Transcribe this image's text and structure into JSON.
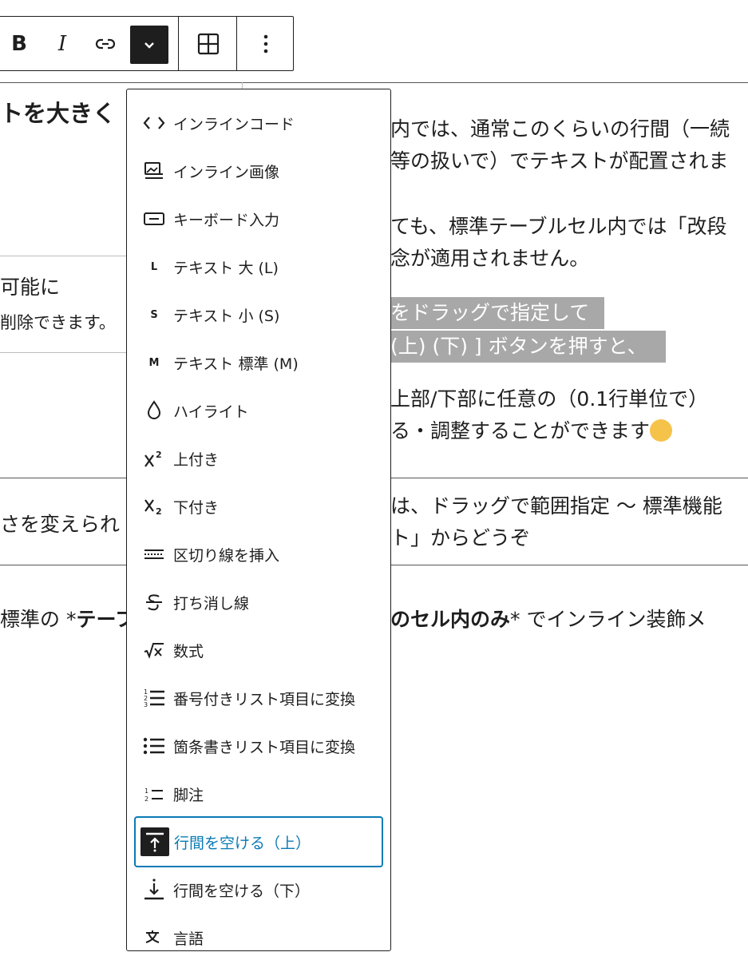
{
  "toolbar": {
    "bold_label": "B",
    "italic_label": "I",
    "link_icon": "link-icon",
    "more_icon": "chevron-down-icon",
    "table_icon": "table-grid-icon",
    "options_icon": "kebab-icon"
  },
  "content": {
    "r1_left": "トを大きく",
    "r1_right_1": "内では、通常このくらいの行間（一続",
    "r1_right_2": "等の扱いで）でテキストが配置されま",
    "r1_right_3": "ても、標準テーブルセル内では「改段",
    "r1_right_4": "念が適用されません。",
    "r2_left_1": "可能に",
    "r2_left_2": "削除できます。",
    "hl_1": "をドラッグで指定して",
    "hl_2": "(上) (下) ] ボタンを押すと、",
    "r2_right_1": "上部/下部に任意の（0.1行単位で）",
    "r2_right_2": "る・調整することができます",
    "r3_left": "さを変えられ",
    "r3_right_1": "は、ドラッグで範囲指定 〜 標準機能",
    "r3_right_2": "ト」からどうぞ",
    "bottom_a": "標準の *",
    "bottom_b": "テーフ",
    "bottom_c": "のセル内のみ",
    "bottom_d": "* でインライン装飾メ"
  },
  "menu": {
    "items": [
      {
        "label": "インラインコード",
        "icon": "code-icon"
      },
      {
        "label": "インライン画像",
        "icon": "image-icon"
      },
      {
        "label": "キーボード入力",
        "icon": "keyboard-icon",
        "glyph": ""
      },
      {
        "label": "テキスト 大 (L)",
        "icon": "text-large-icon",
        "glyph": "L"
      },
      {
        "label": "テキスト 小 (S)",
        "icon": "text-small-icon",
        "glyph": "S"
      },
      {
        "label": "テキスト 標準 (M)",
        "icon": "text-medium-icon",
        "glyph": "M"
      },
      {
        "label": "ハイライト",
        "icon": "highlight-drop-icon"
      },
      {
        "label": "上付き",
        "icon": "superscript-icon"
      },
      {
        "label": "下付き",
        "icon": "subscript-icon"
      },
      {
        "label": "区切り線を挿入",
        "icon": "divider-icon"
      },
      {
        "label": "打ち消し線",
        "icon": "strikethrough-icon"
      },
      {
        "label": "数式",
        "icon": "math-icon"
      },
      {
        "label": "番号付きリスト項目に変換",
        "icon": "ordered-list-icon"
      },
      {
        "label": "箇条書きリスト項目に変換",
        "icon": "bullet-list-icon"
      },
      {
        "label": "脚注",
        "icon": "footnote-icon"
      },
      {
        "label": "行間を空ける（上）",
        "icon": "space-above-icon"
      },
      {
        "label": "行間を空ける（下）",
        "icon": "space-below-icon"
      },
      {
        "label": "言語",
        "icon": "language-icon"
      }
    ]
  },
  "colors": {
    "focus": "#0a7bb5",
    "dark": "#1e1e1e",
    "highlight_bg": "#a8a8a8"
  }
}
